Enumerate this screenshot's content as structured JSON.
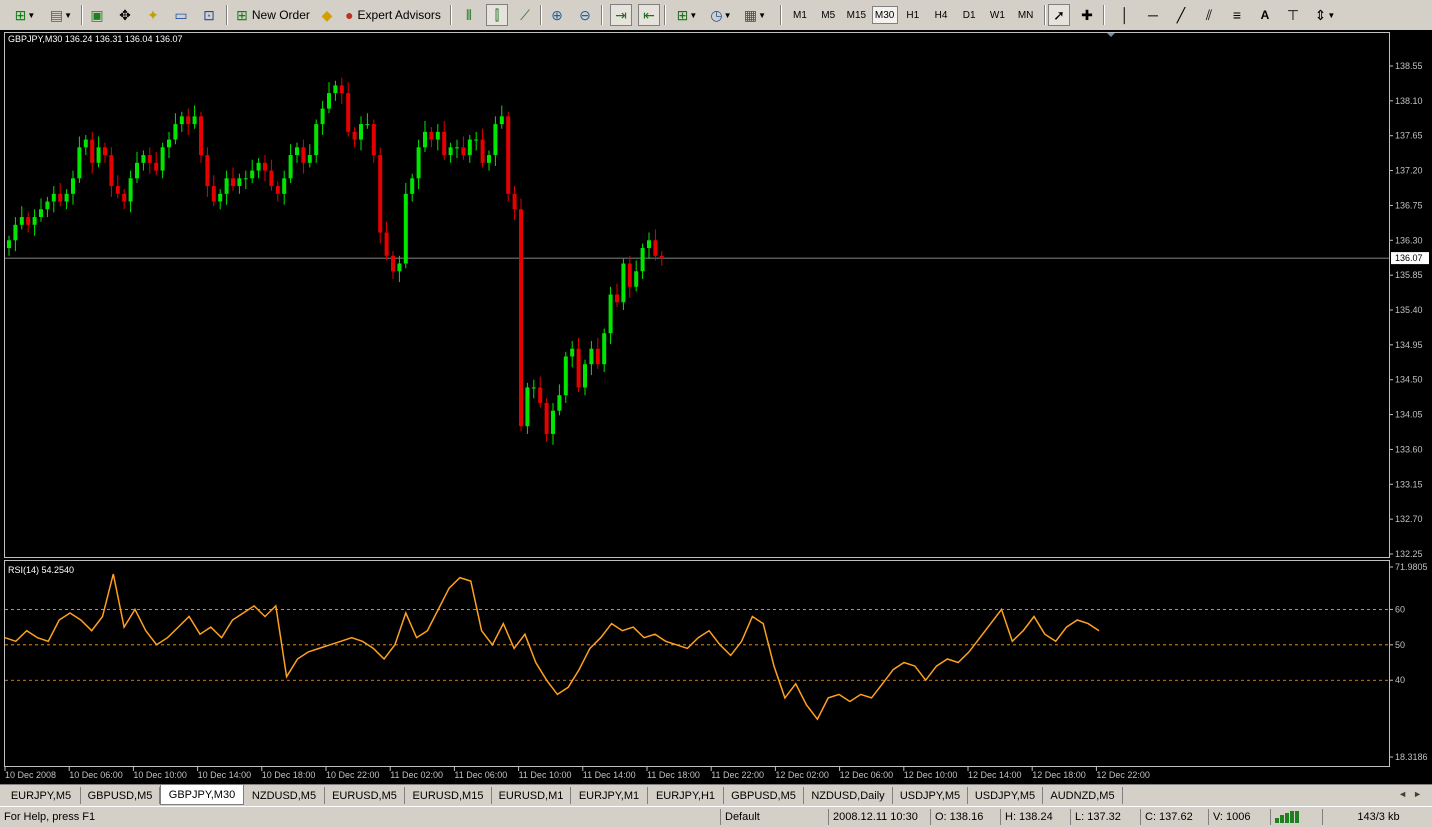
{
  "toolbar": {
    "new_order_label": "New Order",
    "expert_advisors_label": "Expert Advisors",
    "timeframes": [
      "M1",
      "M5",
      "M15",
      "M30",
      "H1",
      "H4",
      "D1",
      "W1",
      "MN"
    ],
    "active_timeframe": "M30"
  },
  "chart": {
    "header_text": "GBPJPY,M30  136.24 136.31 136.04 136.07",
    "current_price_label": "136.07",
    "price_axis_labels": [
      "138.55",
      "138.10",
      "137.65",
      "137.20",
      "136.75",
      "136.30",
      "135.85",
      "135.40",
      "134.95",
      "134.50",
      "134.05",
      "133.60",
      "133.15",
      "132.70",
      "132.25"
    ],
    "rsi_header": "RSI(14) 54.2540",
    "rsi_axis_labels": [
      "71.9805",
      "60",
      "50",
      "40",
      "18.3186"
    ],
    "time_labels": [
      "10 Dec 2008",
      "10 Dec 06:00",
      "10 Dec 10:00",
      "10 Dec 14:00",
      "10 Dec 18:00",
      "10 Dec 22:00",
      "11 Dec 02:00",
      "11 Dec 06:00",
      "11 Dec 10:00",
      "11 Dec 14:00",
      "11 Dec 18:00",
      "11 Dec 22:00",
      "12 Dec 02:00",
      "12 Dec 06:00",
      "12 Dec 10:00",
      "12 Dec 14:00",
      "12 Dec 18:00",
      "12 Dec 22:00"
    ],
    "colors": {
      "bull": "#00e600",
      "bear": "#e60000",
      "rsi": "#ffa020",
      "axis": "#c0c0c0",
      "level": "#ffa020",
      "bid_line": "#b0b0b0"
    }
  },
  "chart_data": {
    "type": "candlestick",
    "symbol": "GBPJPY",
    "timeframe": "M30",
    "ylim": [
      132.25,
      138.55
    ],
    "current_price": 136.07,
    "candles_close_approx": [
      136.3,
      136.5,
      136.6,
      136.5,
      136.6,
      136.7,
      136.8,
      136.9,
      136.8,
      136.9,
      137.1,
      137.5,
      137.6,
      137.3,
      137.5,
      137.4,
      137.0,
      136.9,
      136.8,
      137.1,
      137.3,
      137.4,
      137.3,
      137.2,
      137.5,
      137.6,
      137.8,
      137.9,
      137.8,
      137.9,
      137.4,
      137.0,
      136.8,
      136.9,
      137.1,
      137.0,
      137.1,
      137.1,
      137.2,
      137.3,
      137.2,
      137.0,
      136.9,
      137.1,
      137.4,
      137.5,
      137.3,
      137.4,
      137.8,
      138.0,
      138.2,
      138.3,
      138.2,
      137.7,
      137.6,
      137.8,
      137.8,
      137.4,
      136.4,
      136.1,
      135.9,
      136.0,
      136.9,
      137.1,
      137.5,
      137.7,
      137.6,
      137.7,
      137.4,
      137.5,
      137.5,
      137.4,
      137.6,
      137.6,
      137.3,
      137.4,
      137.8,
      137.9,
      136.9,
      136.7,
      133.9,
      134.4,
      134.4,
      134.2,
      133.8,
      134.1,
      134.3,
      134.8,
      134.9,
      134.4,
      134.7,
      134.9,
      134.7,
      135.1,
      135.6,
      135.5,
      136.0,
      135.7,
      135.9,
      136.2,
      136.3,
      136.1,
      136.07
    ],
    "rsi": {
      "period": 14,
      "current_value": 54.254,
      "levels": [
        60,
        50,
        40
      ],
      "ylim": [
        18.3186,
        71.9805
      ],
      "values": [
        52,
        51,
        54,
        52,
        51,
        57,
        59,
        57,
        54,
        58,
        70,
        55,
        60,
        54,
        50,
        52,
        55,
        58,
        53,
        55,
        52,
        57,
        59,
        61,
        58,
        61,
        41,
        46,
        48,
        49,
        50,
        51,
        52,
        51,
        49,
        46,
        50,
        59,
        52,
        54,
        60,
        66,
        69,
        68,
        54,
        50,
        56,
        49,
        53,
        45,
        40,
        36,
        38,
        43,
        49,
        52,
        56,
        54,
        55,
        52,
        53,
        51,
        50,
        49,
        52,
        54,
        50,
        47,
        51,
        58,
        56,
        44,
        35,
        39,
        33,
        29,
        35,
        36,
        34,
        36,
        35,
        39,
        43,
        45,
        44,
        40,
        44,
        46,
        45,
        48,
        52,
        56,
        60,
        51,
        54,
        58,
        53,
        51,
        55,
        57,
        56,
        54
      ]
    }
  },
  "tabs": {
    "items": [
      "EURJPY,M5",
      "GBPUSD,M5",
      "GBPJPY,M30",
      "NZDUSD,M5",
      "EURUSD,M5",
      "EURUSD,M15",
      "EURUSD,M1",
      "EURJPY,M1",
      "EURJPY,H1",
      "GBPUSD,M5",
      "NZDUSD,Daily",
      "USDJPY,M5",
      "USDJPY,M5",
      "AUDNZD,M5"
    ],
    "active_index": 2
  },
  "status": {
    "help": "For Help, press F1",
    "profile": "Default",
    "datetime": "2008.12.11 10:30",
    "open": "O: 138.16",
    "high": "H: 138.24",
    "low": "L: 137.32",
    "close": "C: 137.62",
    "volume": "V: 1006",
    "traffic": "143/3 kb"
  }
}
